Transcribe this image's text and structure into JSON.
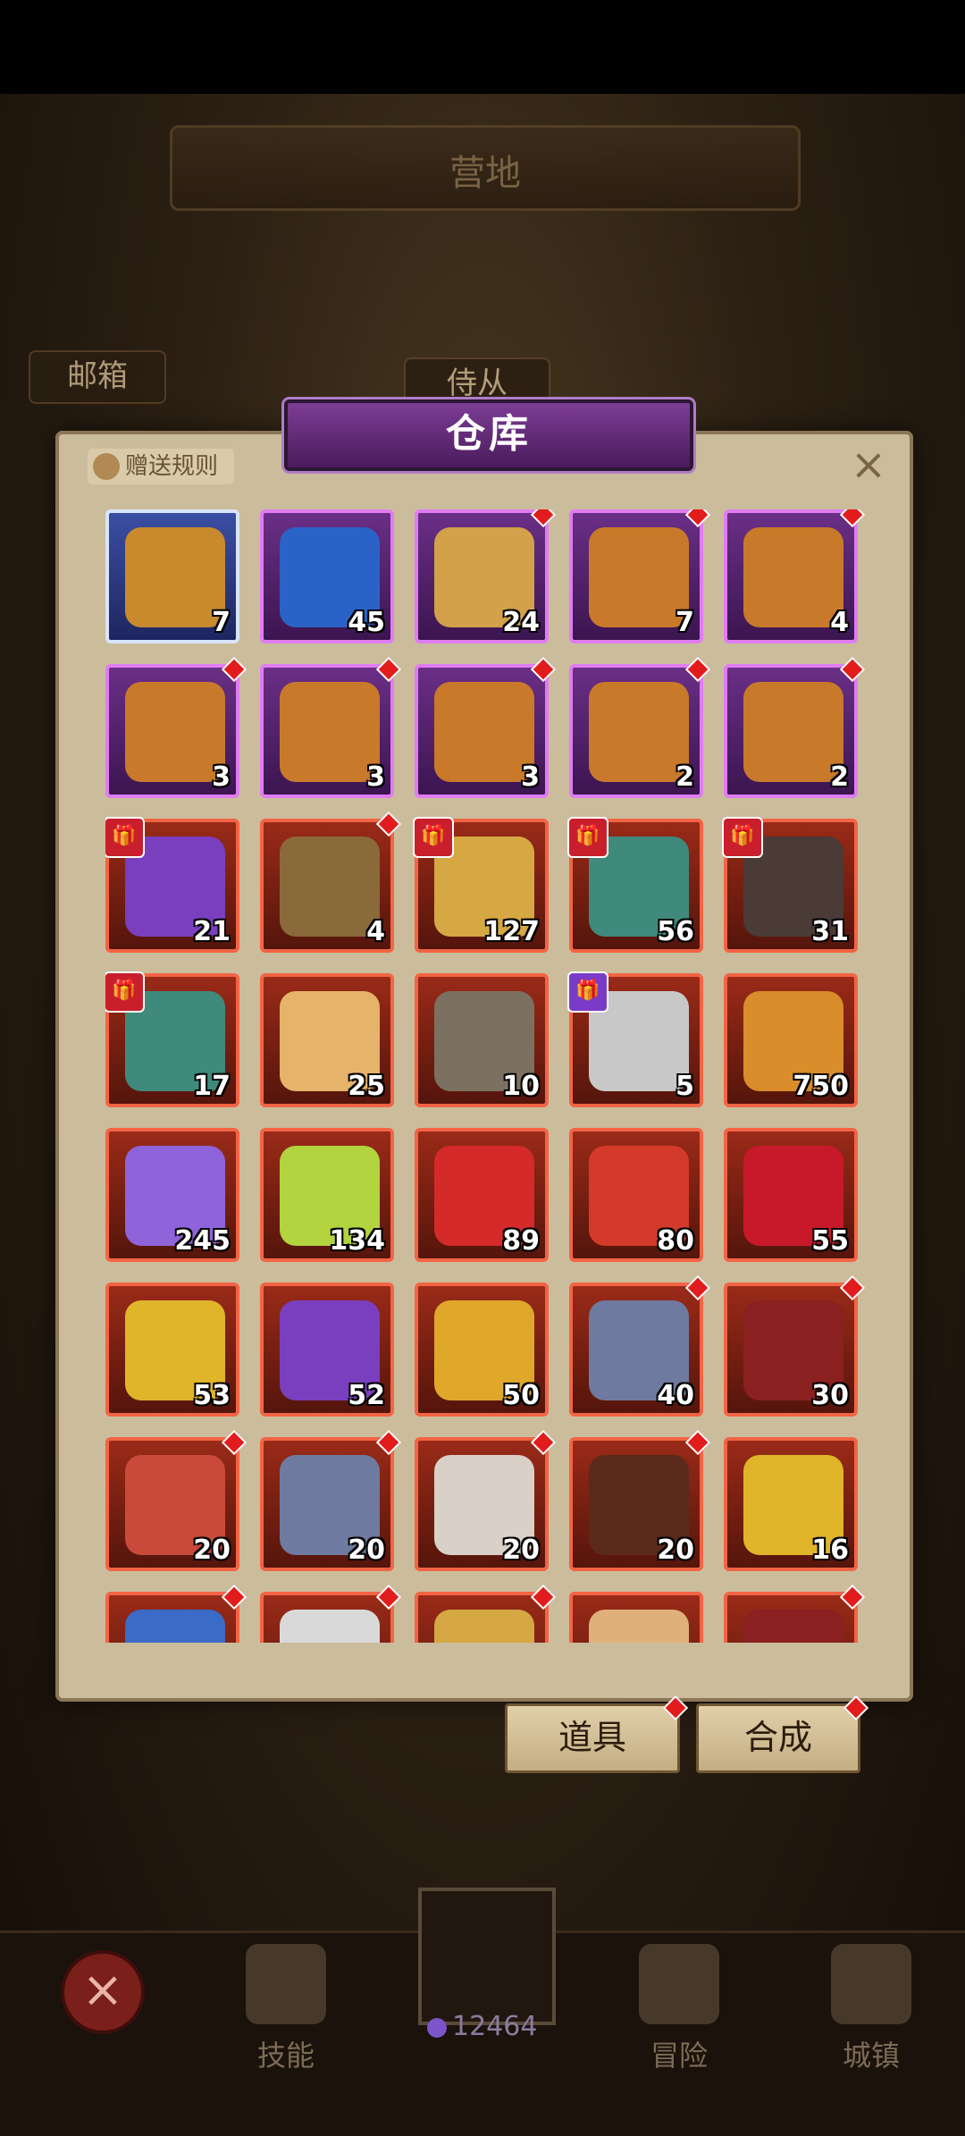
{
  "header": {
    "camp_title": "营地",
    "mailbox": "邮箱",
    "servant": "侍从"
  },
  "warehouse": {
    "title": "仓库",
    "gift_rules": "赠送规则",
    "close": "×"
  },
  "items": [
    {
      "count": "7",
      "color": "blue",
      "badge": "",
      "art": "#c98a2e"
    },
    {
      "count": "45",
      "color": "purple",
      "badge": "",
      "art": "#2a62c7"
    },
    {
      "count": "24",
      "color": "purple",
      "badge": "dot",
      "art": "#d2a14a"
    },
    {
      "count": "7",
      "color": "purple",
      "badge": "dot",
      "art": "#c87a2a"
    },
    {
      "count": "4",
      "color": "purple",
      "badge": "dot",
      "art": "#c87a2a"
    },
    {
      "count": "3",
      "color": "purple",
      "badge": "dot",
      "art": "#c87a2a"
    },
    {
      "count": "3",
      "color": "purple",
      "badge": "dot",
      "art": "#c87a2a"
    },
    {
      "count": "3",
      "color": "purple",
      "badge": "dot",
      "art": "#c87a2a"
    },
    {
      "count": "2",
      "color": "purple",
      "badge": "dot",
      "art": "#c87a2a"
    },
    {
      "count": "2",
      "color": "purple",
      "badge": "dot",
      "art": "#c87a2a"
    },
    {
      "count": "21",
      "color": "red",
      "badge": "gift",
      "art": "#7a3fbf"
    },
    {
      "count": "4",
      "color": "red",
      "badge": "dot",
      "art": "#8a6a3a"
    },
    {
      "count": "127",
      "color": "red",
      "badge": "gift",
      "art": "#d5a843"
    },
    {
      "count": "56",
      "color": "red",
      "badge": "gift",
      "art": "#3f8a7c"
    },
    {
      "count": "31",
      "color": "red",
      "badge": "gift",
      "art": "#4a3b36"
    },
    {
      "count": "17",
      "color": "red",
      "badge": "gift",
      "art": "#3f8a7c"
    },
    {
      "count": "25",
      "color": "red",
      "badge": "",
      "art": "#e6b36a"
    },
    {
      "count": "10",
      "color": "red",
      "badge": "",
      "art": "#7c7160"
    },
    {
      "count": "5",
      "color": "red",
      "badge": "giftp",
      "art": "#c8c8c8"
    },
    {
      "count": "750",
      "color": "red",
      "badge": "",
      "art": "#d98d2b"
    },
    {
      "count": "245",
      "color": "red",
      "badge": "",
      "art": "#8f63d9"
    },
    {
      "count": "134",
      "color": "red",
      "badge": "",
      "art": "#b1d43f"
    },
    {
      "count": "89",
      "color": "red",
      "badge": "",
      "art": "#d42a2a"
    },
    {
      "count": "80",
      "color": "red",
      "badge": "",
      "art": "#d43a2a"
    },
    {
      "count": "55",
      "color": "red",
      "badge": "",
      "art": "#c8192a"
    },
    {
      "count": "53",
      "color": "red",
      "badge": "",
      "art": "#e0b52a"
    },
    {
      "count": "52",
      "color": "red",
      "badge": "",
      "art": "#7a3fbf"
    },
    {
      "count": "50",
      "color": "red",
      "badge": "",
      "art": "#e0a82a"
    },
    {
      "count": "40",
      "color": "red",
      "badge": "dot",
      "art": "#6e7aa0"
    },
    {
      "count": "30",
      "color": "red",
      "badge": "dot",
      "art": "#8a2020"
    },
    {
      "count": "20",
      "color": "red",
      "badge": "dot",
      "art": "#c94a3a"
    },
    {
      "count": "20",
      "color": "red",
      "badge": "dot",
      "art": "#6e7aa0"
    },
    {
      "count": "20",
      "color": "red",
      "badge": "dot",
      "art": "#d9d0c8"
    },
    {
      "count": "20",
      "color": "red",
      "badge": "dot",
      "art": "#5a2a1a"
    },
    {
      "count": "16",
      "color": "red",
      "badge": "",
      "art": "#e0b52a"
    },
    {
      "count": "",
      "color": "red",
      "badge": "dot",
      "art": "#3a6bc7"
    },
    {
      "count": "",
      "color": "red",
      "badge": "dot",
      "art": "#d9d9d9"
    },
    {
      "count": "",
      "color": "red",
      "badge": "dot",
      "art": "#d5a843"
    },
    {
      "count": "",
      "color": "red",
      "badge": "",
      "art": "#e0b07a"
    },
    {
      "count": "",
      "color": "red",
      "badge": "dot",
      "art": "#8a2020"
    }
  ],
  "tabs": {
    "props": "道具",
    "synth": "合成"
  },
  "nav": {
    "skills": "技能",
    "gems": "12464",
    "adventure": "冒险",
    "town": "城镇",
    "x": "×"
  }
}
